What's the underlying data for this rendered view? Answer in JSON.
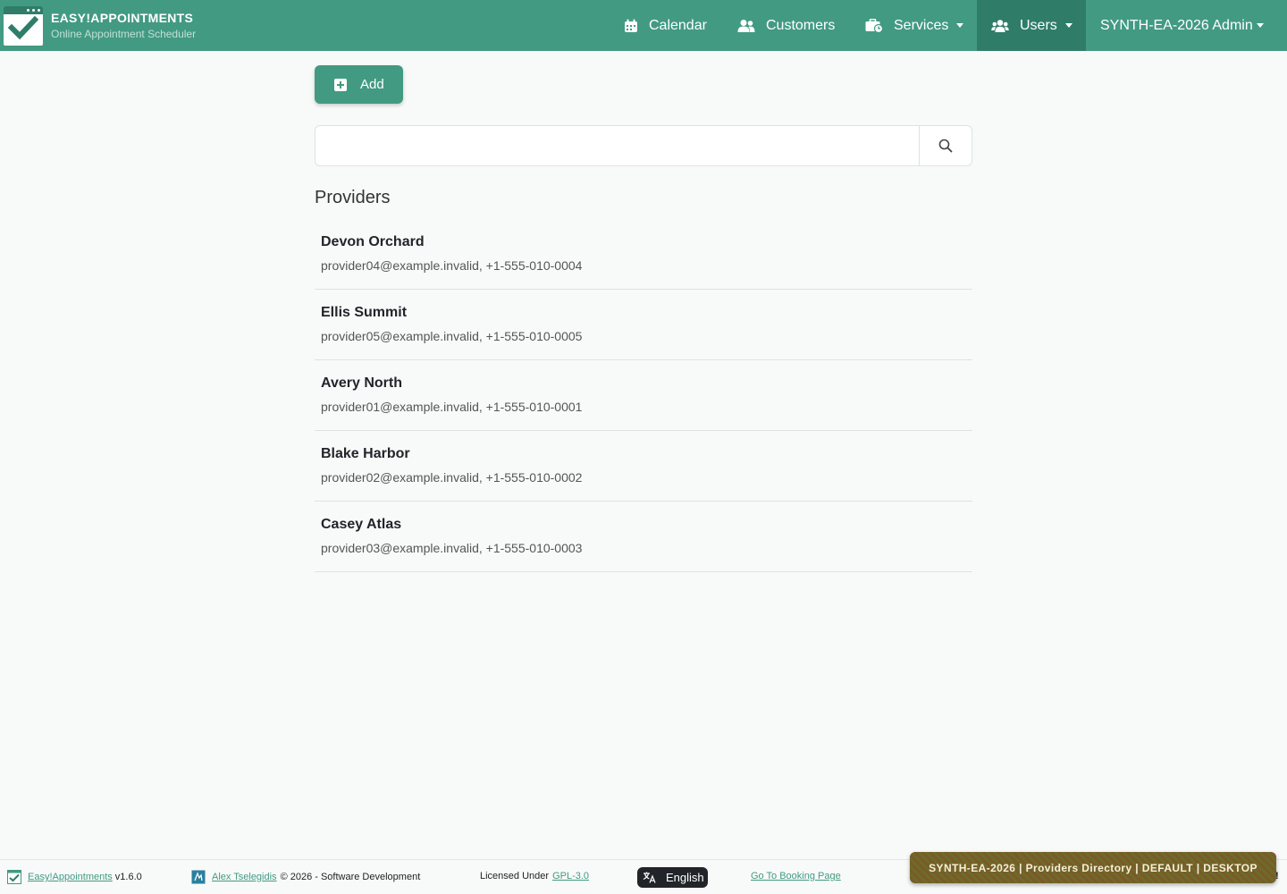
{
  "header": {
    "brand_title": "EASY!APPOINTMENTS",
    "brand_subtitle": "Online Appointment Scheduler",
    "nav": {
      "calendar": "Calendar",
      "customers": "Customers",
      "services": "Services",
      "users": "Users",
      "admin": "SYNTH-EA-2026 Admin"
    },
    "accent_color": "#429a82",
    "active_color": "#2f7d68"
  },
  "main": {
    "add_label": "Add",
    "search": {
      "value": "",
      "placeholder": ""
    },
    "section_title": "Providers",
    "providers": [
      {
        "name": "Devon Orchard",
        "info": "provider04@example.invalid, +1-555-010-0004"
      },
      {
        "name": "Ellis Summit",
        "info": "provider05@example.invalid, +1-555-010-0005"
      },
      {
        "name": "Avery North",
        "info": "provider01@example.invalid, +1-555-010-0001"
      },
      {
        "name": "Blake Harbor",
        "info": "provider02@example.invalid, +1-555-010-0002"
      },
      {
        "name": "Casey Atlas",
        "info": "provider03@example.invalid, +1-555-010-0003"
      }
    ]
  },
  "footer": {
    "app_link": "Easy!Appointments",
    "version": "v1.6.0",
    "author_link": "Alex Tselegidis",
    "copyright": "© 2026 - Software Development",
    "license_prefix": "Licensed Under",
    "license_link": "GPL-3.0",
    "language": "English",
    "booking_link": "Go To Booking Page",
    "banner": "SYNTH-EA-2026 | Providers Directory | DEFAULT | DESKTOP",
    "banner_suffix": "!"
  }
}
